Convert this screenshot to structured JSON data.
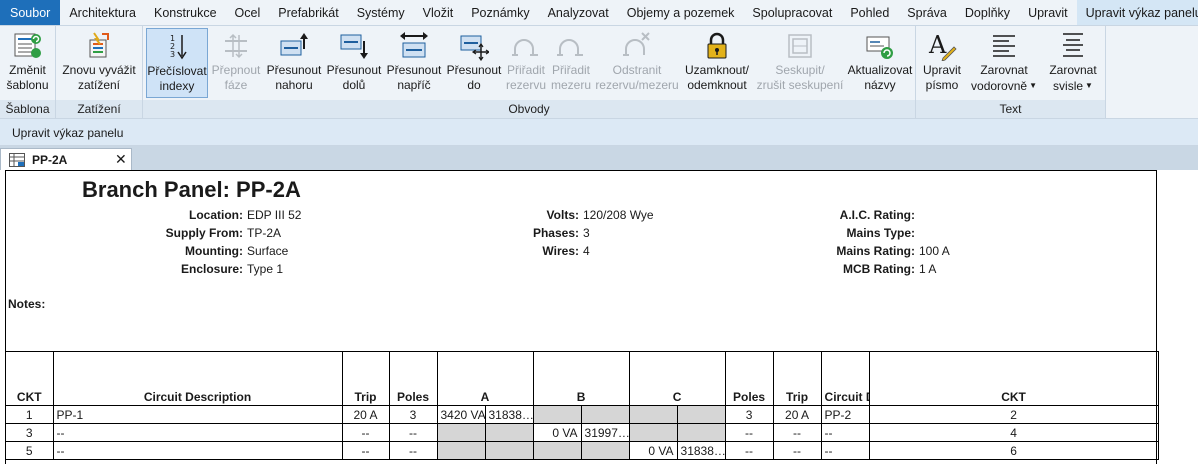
{
  "menu": {
    "tabs": [
      "Soubor",
      "Architektura",
      "Konstrukce",
      "Ocel",
      "Prefabrikát",
      "Systémy",
      "Vložit",
      "Poznámky",
      "Analyzovat",
      "Objemy a pozemek",
      "Spolupracovat",
      "Pohled",
      "Správa",
      "Doplňky",
      "Upravit",
      "Upravit výkaz panelu"
    ]
  },
  "ribbon": {
    "sablona": {
      "title": "Šablona",
      "change": [
        "Změnit",
        "šablonu"
      ]
    },
    "zatizeni": {
      "title": "Zatížení",
      "rebalance": [
        "Znovu vyvážit",
        "zatížení"
      ]
    },
    "obvody": {
      "title": "Obvody",
      "renumber": [
        "Přečíslovat",
        "indexy"
      ],
      "switch_phases": [
        "Přepnout",
        "fáze"
      ],
      "move_up": [
        "Přesunout",
        "nahoru"
      ],
      "move_down": [
        "Přesunout",
        "dolů"
      ],
      "move_across": [
        "Přesunout",
        "napříč"
      ],
      "move_to": [
        "Přesunout",
        "do"
      ],
      "assign_spare": [
        "Přiřadit",
        "rezervu"
      ],
      "assign_space": [
        "Přiřadit",
        "mezeru"
      ],
      "remove_spare": [
        "Odstranit",
        "rezervu/mezeru"
      ],
      "lock": [
        "Uzamknout/",
        "odemknout"
      ],
      "group": [
        "Seskupit/",
        "zrušit seskupení"
      ],
      "update_names": [
        "Aktualizovat",
        "názvy"
      ]
    },
    "text": {
      "title": "Text",
      "edit_font": [
        "Upravit",
        "písmo"
      ],
      "align_h": [
        "Zarovnat",
        "vodorovně"
      ],
      "align_v": [
        "Zarovnat",
        "svisle"
      ]
    }
  },
  "context_label": "Upravit výkaz panelu",
  "doc_tab": {
    "name": "PP-2A",
    "close": "✕"
  },
  "schedule": {
    "title": "Branch Panel: PP-2A",
    "fields_left": [
      {
        "label": "Location:",
        "value": "EDP III 52"
      },
      {
        "label": "Supply From:",
        "value": "TP-2A"
      },
      {
        "label": "Mounting:",
        "value": "Surface"
      },
      {
        "label": "Enclosure:",
        "value": "Type 1"
      }
    ],
    "fields_mid": [
      {
        "label": "Volts:",
        "value": "120/208 Wye"
      },
      {
        "label": "Phases:",
        "value": "3"
      },
      {
        "label": "Wires:",
        "value": "4"
      }
    ],
    "fields_right": [
      {
        "label": "A.I.C. Rating:",
        "value": ""
      },
      {
        "label": "Mains Type:",
        "value": ""
      },
      {
        "label": "Mains Rating:",
        "value": "100 A"
      },
      {
        "label": "MCB Rating:",
        "value": "1 A"
      }
    ],
    "notes_label": "Notes:",
    "headers": [
      "CKT",
      "Circuit Description",
      "Trip",
      "Poles",
      "A",
      "B",
      "C",
      "Poles",
      "Trip",
      "Circuit Description",
      "CKT"
    ],
    "rows": [
      {
        "ckt_l": "1",
        "desc_l": "PP-1",
        "trip_l": "20 A",
        "poles_l": "3",
        "a1": "3420 VA",
        "a2": "31838…",
        "b1": "",
        "b2": "",
        "c1": "",
        "c2": "",
        "poles_r": "3",
        "trip_r": "20 A",
        "desc_r": "PP-2",
        "ckt_r": "2"
      },
      {
        "ckt_l": "3",
        "desc_l": "--",
        "trip_l": "--",
        "poles_l": "--",
        "a1": "",
        "a2": "",
        "b1": "0 VA",
        "b2": "31997…",
        "c1": "",
        "c2": "",
        "poles_r": "--",
        "trip_r": "--",
        "desc_r": "--",
        "ckt_r": "4"
      },
      {
        "ckt_l": "5",
        "desc_l": "--",
        "trip_l": "--",
        "poles_l": "--",
        "a1": "",
        "a2": "",
        "b1": "",
        "b2": "",
        "c1": "0 VA",
        "c2": "31838…",
        "poles_r": "--",
        "trip_r": "--",
        "desc_r": "--",
        "ckt_r": "6"
      }
    ]
  }
}
